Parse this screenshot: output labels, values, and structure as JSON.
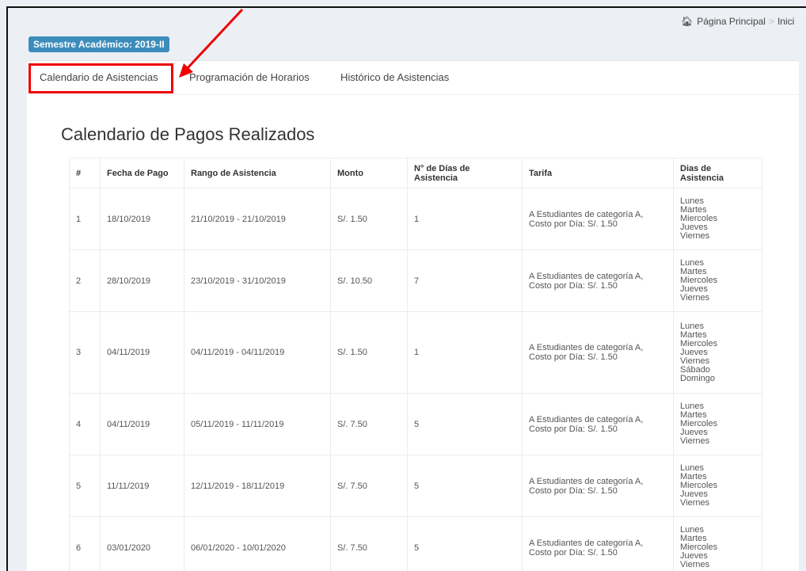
{
  "breadcrumb": {
    "home": "Página Principal",
    "separator": ">",
    "next": "Inici"
  },
  "semester_badge": "Semestre Académico: 2019-II",
  "tabs": [
    {
      "label": "Calendario de Asistencias",
      "active": true
    },
    {
      "label": "Programación de Horarios",
      "active": false
    },
    {
      "label": "Histórico de Asistencias",
      "active": false
    }
  ],
  "page_title": "Calendario de Pagos Realizados",
  "table": {
    "headers": [
      "#",
      "Fecha de Pago",
      "Rango de Asistencia",
      "Monto",
      "N° de Días de Asistencia",
      "Tarifa",
      "Dias de Asistencia"
    ],
    "rows": [
      {
        "num": "1",
        "fecha": "18/10/2019",
        "rango": "21/10/2019 - 21/10/2019",
        "monto": "S/. 1.50",
        "dias": "1",
        "tarifa_1": "A Estudiantes de categoría A,",
        "tarifa_2": "Costo por Día: S/. 1.50",
        "dias_asistencia": [
          "Lunes",
          "Martes",
          "Miercoles",
          "Jueves",
          "Viernes"
        ]
      },
      {
        "num": "2",
        "fecha": "28/10/2019",
        "rango": "23/10/2019 - 31/10/2019",
        "monto": "S/. 10.50",
        "dias": "7",
        "tarifa_1": "A Estudiantes de categoría A,",
        "tarifa_2": "Costo por Día: S/. 1.50",
        "dias_asistencia": [
          "Lunes",
          "Martes",
          "Miercoles",
          "Jueves",
          "Viernes"
        ]
      },
      {
        "num": "3",
        "fecha": "04/11/2019",
        "rango": "04/11/2019 - 04/11/2019",
        "monto": "S/. 1.50",
        "dias": "1",
        "tarifa_1": "A Estudiantes de categoría A,",
        "tarifa_2": "Costo por Día: S/. 1.50",
        "dias_asistencia": [
          "Lunes",
          "Martes",
          "Miercoles",
          "Jueves",
          "Viernes",
          "Sábado",
          "Domingo"
        ]
      },
      {
        "num": "4",
        "fecha": "04/11/2019",
        "rango": "05/11/2019 - 11/11/2019",
        "monto": "S/. 7.50",
        "dias": "5",
        "tarifa_1": "A Estudiantes de categoría A,",
        "tarifa_2": "Costo por Día: S/. 1.50",
        "dias_asistencia": [
          "Lunes",
          "Martes",
          "Miercoles",
          "Jueves",
          "Viernes"
        ]
      },
      {
        "num": "5",
        "fecha": "11/11/2019",
        "rango": "12/11/2019 - 18/11/2019",
        "monto": "S/. 7.50",
        "dias": "5",
        "tarifa_1": "A Estudiantes de categoría A,",
        "tarifa_2": "Costo por Día: S/. 1.50",
        "dias_asistencia": [
          "Lunes",
          "Martes",
          "Miercoles",
          "Jueves",
          "Viernes"
        ]
      },
      {
        "num": "6",
        "fecha": "03/01/2020",
        "rango": "06/01/2020 - 10/01/2020",
        "monto": "S/. 7.50",
        "dias": "5",
        "tarifa_1": "A Estudiantes de categoría A,",
        "tarifa_2": "Costo por Día: S/. 1.50",
        "dias_asistencia": [
          "Lunes",
          "Martes",
          "Miercoles",
          "Jueves",
          "Viernes"
        ]
      }
    ]
  },
  "colors": {
    "badge": "#3c8dbc",
    "highlight": "#e00000",
    "background": "#ecf0f5"
  }
}
